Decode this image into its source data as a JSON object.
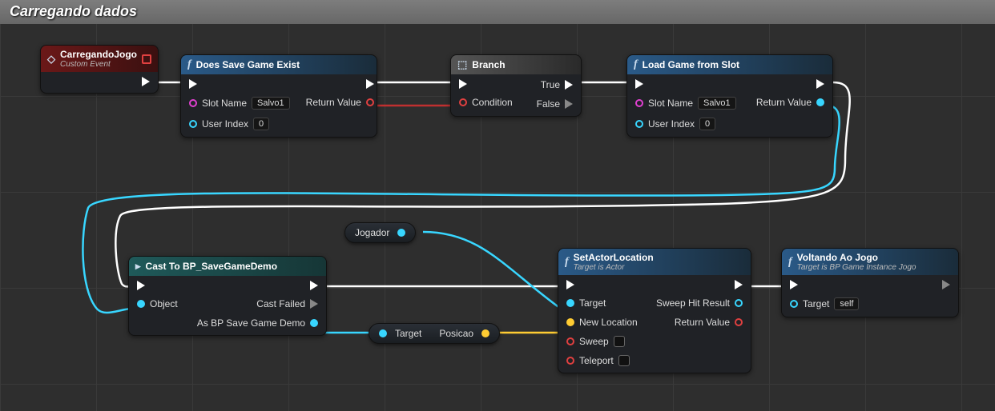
{
  "panel_title": "Carregando dados",
  "nodes": {
    "event": {
      "title": "CarregandoJogo",
      "subtitle": "Custom Event"
    },
    "doesExist": {
      "title": "Does Save Game Exist",
      "slot_label": "Slot Name",
      "slot_value": "Salvo1",
      "user_label": "User Index",
      "user_value": "0",
      "ret_label": "Return Value"
    },
    "branch": {
      "title": "Branch",
      "cond": "Condition",
      "true": "True",
      "false": "False"
    },
    "load": {
      "title": "Load Game from Slot",
      "slot_label": "Slot Name",
      "slot_value": "Salvo1",
      "user_label": "User Index",
      "user_value": "0",
      "ret_label": "Return Value"
    },
    "jogador": {
      "label": "Jogador"
    },
    "cast": {
      "title": "Cast To BP_SaveGameDemo",
      "object": "Object",
      "failed": "Cast Failed",
      "as": "As BP Save Game Demo"
    },
    "targetPosicao": {
      "target": "Target",
      "posicao": "Posicao"
    },
    "setLoc": {
      "title": "SetActorLocation",
      "subtitle": "Target is Actor",
      "target": "Target",
      "newLoc": "New Location",
      "sweep": "Sweep",
      "teleport": "Teleport",
      "hit": "Sweep Hit Result",
      "ret": "Return Value"
    },
    "voltando": {
      "title": "Voltando Ao Jogo",
      "subtitle": "Target is BP Game Instance Jogo",
      "target_label": "Target",
      "target_value": "self"
    }
  }
}
